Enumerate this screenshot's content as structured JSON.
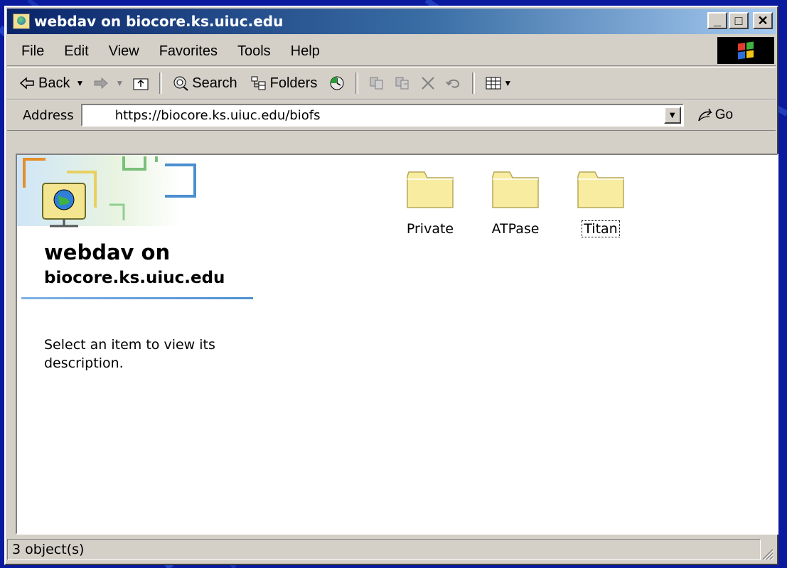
{
  "window": {
    "title": "webdav on biocore.ks.uiuc.edu",
    "minimize_label": "_",
    "maximize_label": "□",
    "close_label": "✕"
  },
  "menubar": {
    "items": [
      "File",
      "Edit",
      "View",
      "Favorites",
      "Tools",
      "Help"
    ]
  },
  "toolbar": {
    "back_label": "Back",
    "search_label": "Search",
    "folders_label": "Folders"
  },
  "address": {
    "label": "Address",
    "value": "https://biocore.ks.uiuc.edu/biofs",
    "go_label": "Go"
  },
  "sidebar": {
    "title": "webdav on",
    "subtitle": "biocore.ks.uiuc.edu",
    "description": "Select an item to view its description."
  },
  "folders": [
    {
      "label": "Private"
    },
    {
      "label": "ATPase"
    },
    {
      "label": "Titan"
    }
  ],
  "status": {
    "text": "3 object(s)"
  },
  "colors": {
    "desktop": "#0a1a9e",
    "titlebar_start": "#0a246a",
    "titlebar_end": "#a6caf0",
    "chrome": "#d4d0c8",
    "folder_fill": "#f8eca0"
  }
}
